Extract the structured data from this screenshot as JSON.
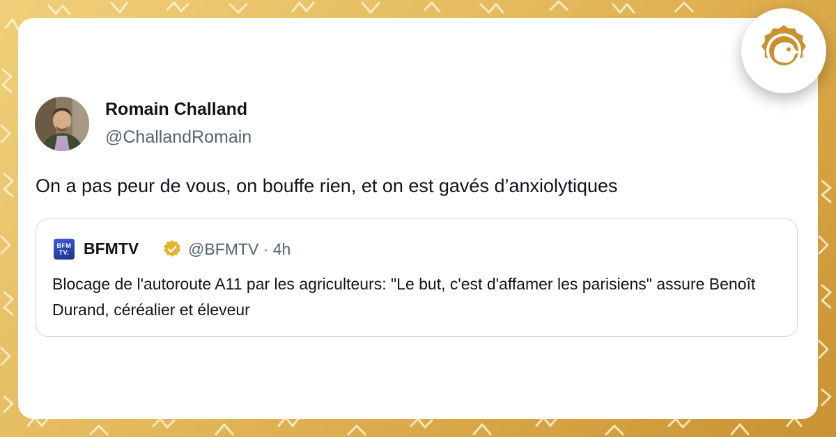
{
  "post": {
    "author_name": "Romain Challand",
    "author_handle": "@ChallandRomain",
    "text": "On a pas peur de vous, on bouffe rien, et on est gavés d’anxiolytiques"
  },
  "quoted": {
    "logo_text_1": "BFM",
    "logo_text_2": "TV.",
    "name": "BFMTV",
    "handle": "@BFMTV",
    "separator": "·",
    "time": "4h",
    "text": "Blocage de l'autoroute A11 par les agriculteurs: \"Le but, c'est d'affamer les parisiens\" assure Benoît Durand, céréalier et éleveur"
  },
  "icons": {
    "verified": "verified-badge-icon",
    "brand": "brand-chick-icon"
  },
  "colors": {
    "background_gold": "#e3b85a",
    "badge_gold": "#c9912f",
    "verified_gold": "#e8b12a",
    "handle_gray": "#536471",
    "text_dark": "#0f1419"
  }
}
